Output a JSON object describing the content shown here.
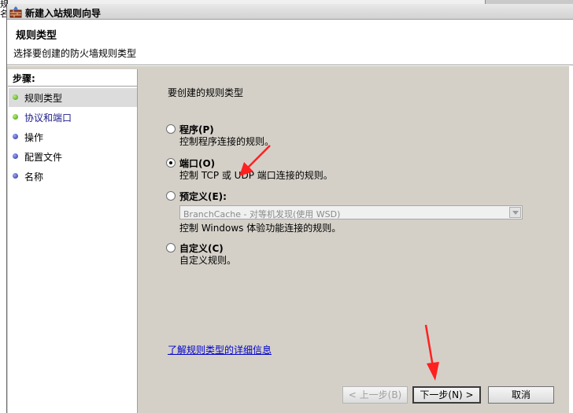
{
  "background": {
    "left_chars": [
      "规",
      "名"
    ]
  },
  "window": {
    "title": "新建入站规则向导"
  },
  "header": {
    "title": "规则类型",
    "subtitle": "选择要创建的防火墙规则类型"
  },
  "steps": {
    "title": "步骤:",
    "items": [
      {
        "label": "规则类型",
        "state": "current"
      },
      {
        "label": "协议和端口",
        "state": "next"
      },
      {
        "label": "操作",
        "state": "pending"
      },
      {
        "label": "配置文件",
        "state": "pending"
      },
      {
        "label": "名称",
        "state": "pending"
      }
    ]
  },
  "main": {
    "prompt": "要创建的规则类型",
    "options": [
      {
        "label": "程序(P)",
        "description": "控制程序连接的规则。",
        "checked": false
      },
      {
        "label": "端口(O)",
        "description": "控制 TCP 或 UDP 端口连接的规则。",
        "checked": true
      },
      {
        "label": "预定义(E):",
        "description": "控制 Windows 体验功能连接的规则。",
        "checked": false
      },
      {
        "label": "自定义(C)",
        "description": "自定义规则。",
        "checked": false
      }
    ],
    "predefined_select": {
      "value": "BranchCache - 对等机发现(使用 WSD)",
      "enabled": false
    },
    "learn_more_link": "了解规则类型的详细信息"
  },
  "buttons": {
    "back": "< 上一步(B)",
    "next": "下一步(N) >",
    "cancel": "取消"
  },
  "colors": {
    "panel_bg": "#d4d0c8",
    "link": "#0000cc",
    "annotation_arrow": "#ff2020"
  }
}
